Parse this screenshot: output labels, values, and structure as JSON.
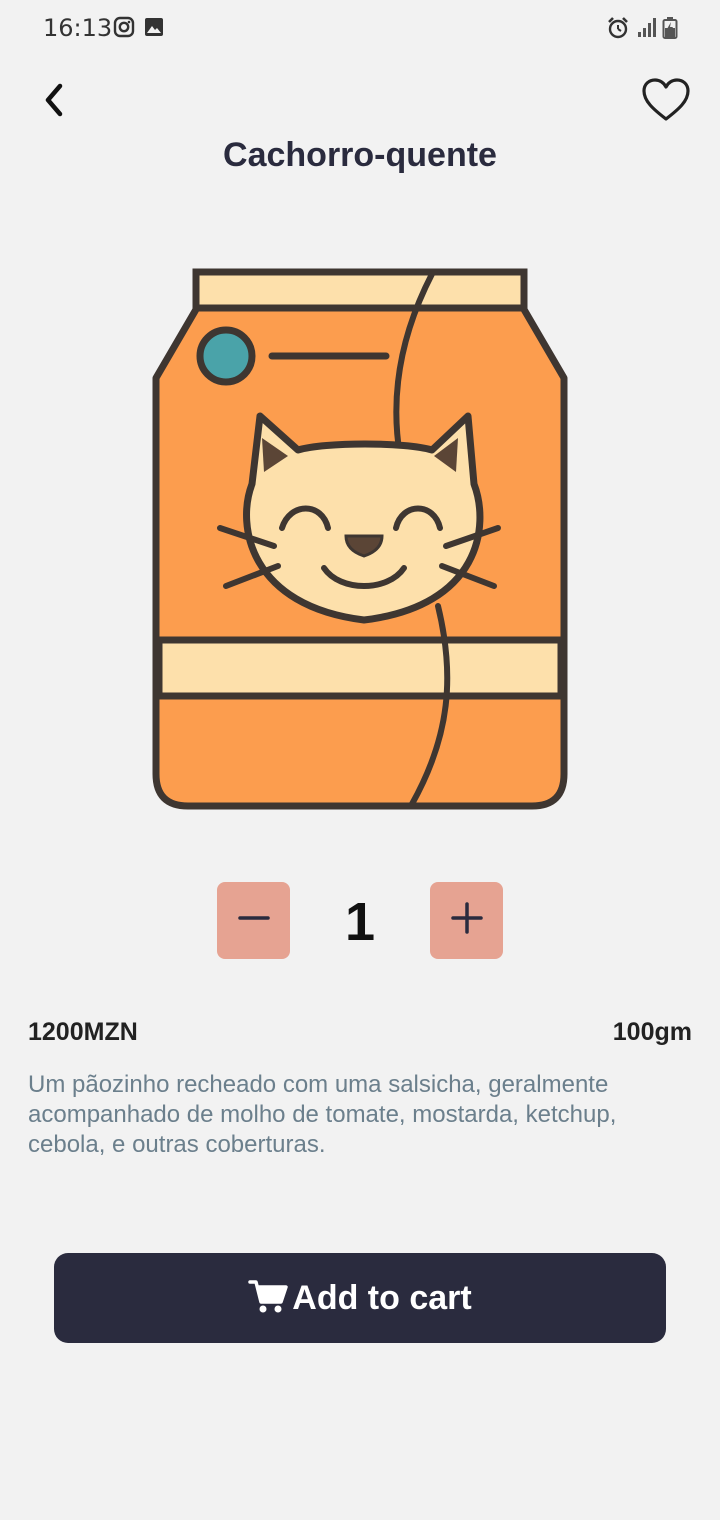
{
  "status_bar": {
    "time": "16:13",
    "left_icons": [
      "instagram-icon",
      "image-icon"
    ],
    "right_icons": [
      "alarm-icon",
      "signal-icon",
      "battery-icon"
    ]
  },
  "header": {
    "title": "Cachorro-quente",
    "back_icon": "chevron-left-icon",
    "favorite_icon": "heart-outline-icon"
  },
  "product": {
    "image": "cat-food-bag-illustration",
    "quantity": "1",
    "price": "1200MZN",
    "weight": "100gm",
    "description": "Um pãozinho recheado com uma salsicha, geralmente acompanhado de molho de tomate, mostarda, ketchup, cebola, e outras coberturas."
  },
  "actions": {
    "add_to_cart_label": "Add to cart",
    "cart_icon": "cart-icon"
  },
  "colors": {
    "background": "#f2f2f2",
    "primary_dark": "#2a2b3e",
    "stepper_button": "#e6a392",
    "description_text": "#6b7f8c",
    "bag_orange": "#fc9d4e",
    "bag_cream": "#fde0ab",
    "teal_dot": "#4aa3a9",
    "outline": "#3e3631"
  }
}
